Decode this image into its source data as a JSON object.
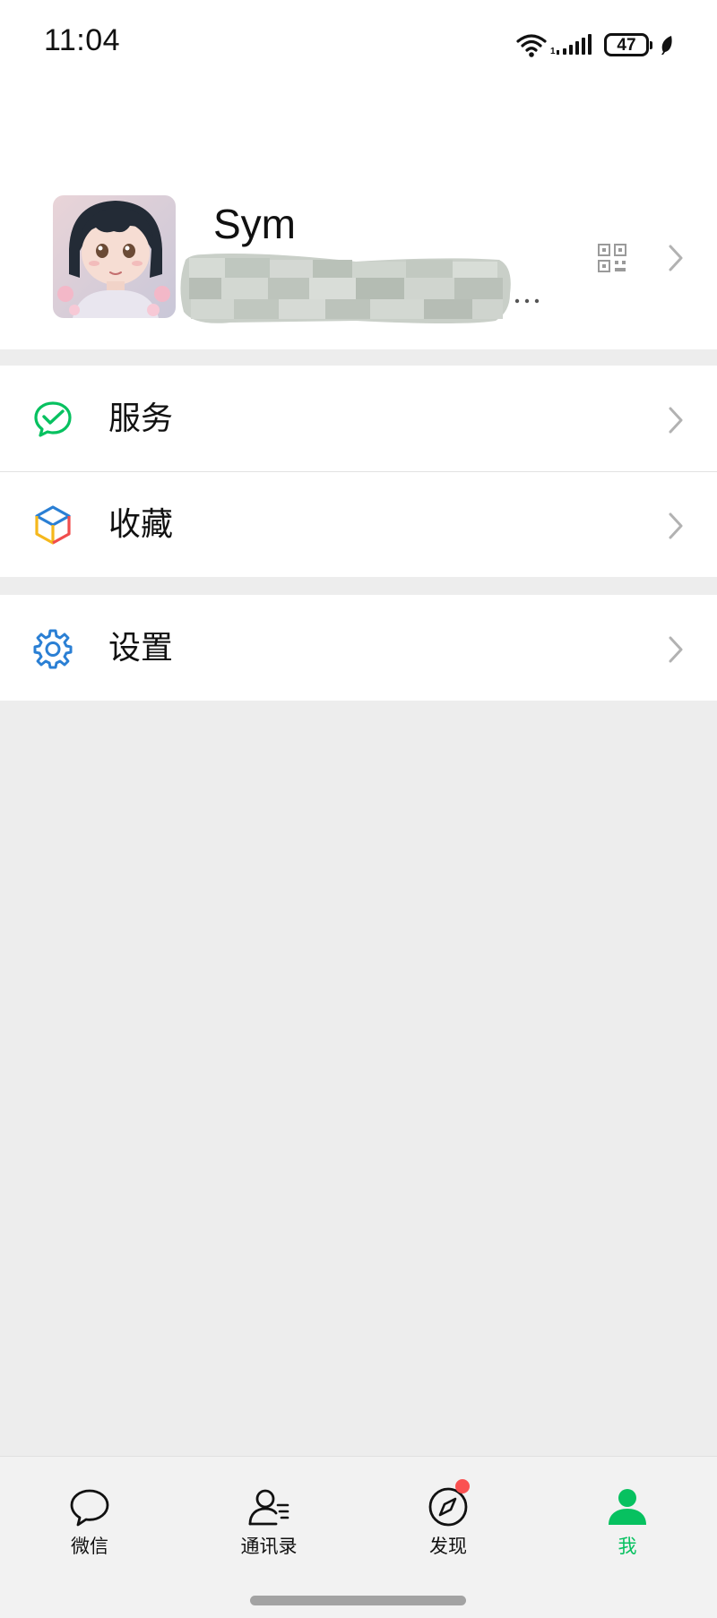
{
  "status_bar": {
    "time": "11:04",
    "battery": "47",
    "signal_icon": "signal-icon",
    "wifi_icon": "wifi-icon"
  },
  "profile": {
    "name": "Sym",
    "wechat_id": "…",
    "qr_icon": "qr-code-icon",
    "chevron_icon": "chevron-right-icon"
  },
  "menu": {
    "groups": [
      {
        "items": [
          {
            "label": "服务",
            "icon": "services-icon",
            "color": "#07c160"
          },
          {
            "label": "收藏",
            "icon": "favorites-icon"
          }
        ]
      },
      {
        "items": [
          {
            "label": "设置",
            "icon": "settings-icon",
            "color": "#2a7fd4"
          }
        ]
      }
    ]
  },
  "tab_bar": {
    "tabs": [
      {
        "label": "微信",
        "icon": "chat-icon"
      },
      {
        "label": "通讯录",
        "icon": "contacts-icon"
      },
      {
        "label": "发现",
        "icon": "discover-icon"
      },
      {
        "label": "我",
        "icon": "me-icon"
      }
    ],
    "active_index": 3,
    "active_color": "#07c160",
    "badge_color": "#fa5151"
  }
}
